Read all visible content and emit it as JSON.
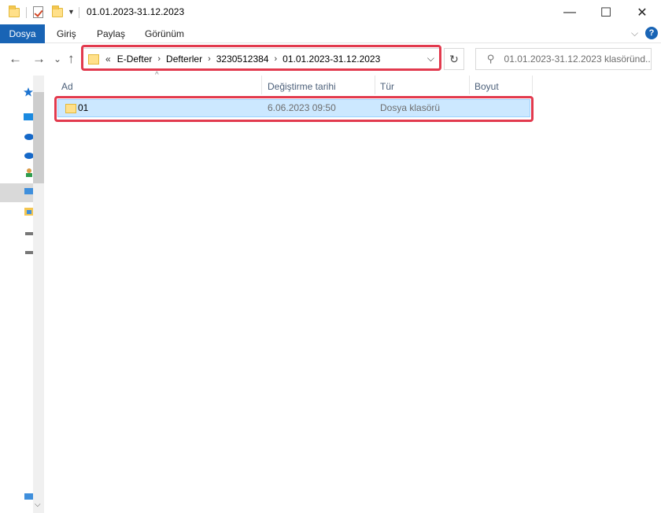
{
  "window": {
    "title": "01.01.2023-31.12.2023",
    "minimize": "—",
    "maximize": "☐",
    "close": "✕"
  },
  "ribbon": {
    "tabs": [
      "Dosya",
      "Giriş",
      "Paylaş",
      "Görünüm"
    ],
    "active_tab": "Dosya",
    "accent_color": "#1964b5",
    "help_label": "?"
  },
  "navigation": {
    "back": "←",
    "forward": "→",
    "recent": "⌄",
    "up": "↑",
    "breadcrumb_lead": "«",
    "breadcrumbs": [
      "E-Defter",
      "Defterler",
      "3230512384",
      "01.01.2023-31.12.2023"
    ],
    "refresh": "↻",
    "search_placeholder": "01.01.2023-31.12.2023 klasöründ..."
  },
  "columns": [
    "Ad",
    "Değiştirme tarihi",
    "Tür",
    "Boyut"
  ],
  "files": [
    {
      "name": "01",
      "modified": "6.06.2023 09:50",
      "type": "Dosya klasörü",
      "size": ""
    }
  ],
  "highlight_color": "#e23a4e",
  "selection_color": "#cce8ff"
}
